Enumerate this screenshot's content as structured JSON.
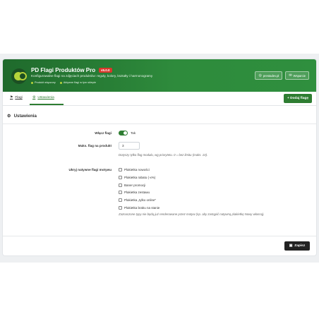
{
  "header": {
    "title": "PD Flagi Produktów Pro",
    "version": "v5.0.0",
    "subtitle": "Konfigurowalne flagi na zdjęciach produktów: reguły, kolory, kształty i harmonogramy",
    "tags": [
      "Produkt włączony",
      "Aktywne flagi w tym sklepie"
    ],
    "buttons": [
      {
        "label": "prestadev.pl",
        "icon": "globe-icon"
      },
      {
        "label": "Wsparcie",
        "icon": "mail-icon"
      }
    ]
  },
  "tabs": [
    {
      "label": "Flagi",
      "icon": "flag-icon"
    },
    {
      "label": "Ustawienia",
      "icon": "gears-icon"
    }
  ],
  "add_flag_label": "+ Dodaj flagę",
  "settings": {
    "title": "Ustawienia",
    "enable_label": "Włącz flagi",
    "enable_value": "Tak",
    "max_label": "Maks. flag na produkt",
    "max_value": "3",
    "max_help": "Dotyczy tylko flag modułu, wg priorytetu. 0 = bez limitu (maks. 10).",
    "hide_label": "Ukryj natywne flagi motywu",
    "hide_options": [
      "Plakietka nowości",
      "Plakietka rabatu (-x%)",
      "Baner promocji",
      "Plakietka zestawu",
      "Plakietka „tylko online”",
      "Plakietka braku na stanie"
    ],
    "hide_help": "Zaznaczone typy nie będą już renderowane przez motyw (np. aby zastąpić natywną plakietkę Nowy własną)."
  },
  "save_label": "Zapisz"
}
